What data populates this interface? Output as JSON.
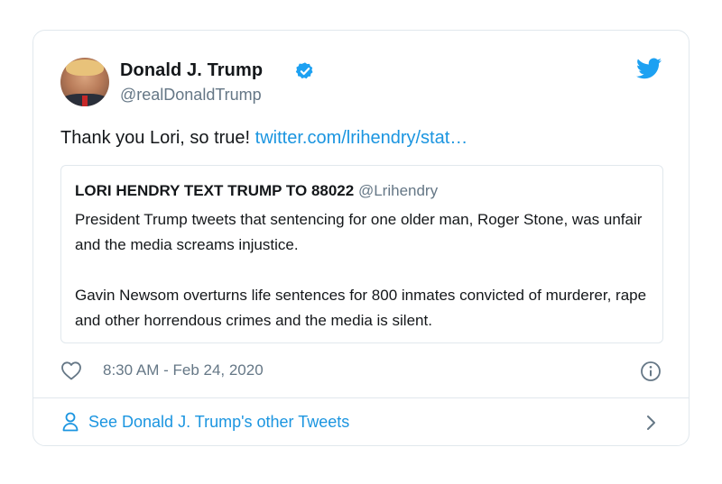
{
  "tweet": {
    "author_name": "Donald J. Trump",
    "author_handle": "@realDonaldTrump",
    "text": "Thank you Lori, so true! ",
    "link_text": "twitter.com/lrihendry/stat…",
    "timestamp": "8:30 AM - Feb 24, 2020"
  },
  "quoted_tweet": {
    "author_name": "LORI HENDRY TEXT TRUMP TO 88022",
    "author_handle": "@Lrihendry",
    "paragraph_1": "President Trump tweets that sentencing for one older man, Roger Stone, was unfair and the media screams injustice.",
    "paragraph_2": "Gavin Newsom overturns life sentences for 800 inmates convicted of murderer, rape and other horrendous crimes and the media is silent."
  },
  "footer": {
    "see_more_label": "See Donald J. Trump's other Tweets"
  },
  "icons": {
    "verified": "verified-badge-icon",
    "bird": "twitter-bird-icon",
    "like": "heart-icon",
    "info": "info-icon",
    "person": "person-icon",
    "chevron": "chevron-right-icon"
  },
  "colors": {
    "brand_blue": "#1da1f2",
    "link_blue": "#1b95e0",
    "secondary_text": "#657786",
    "border": "#e1e8ed"
  }
}
